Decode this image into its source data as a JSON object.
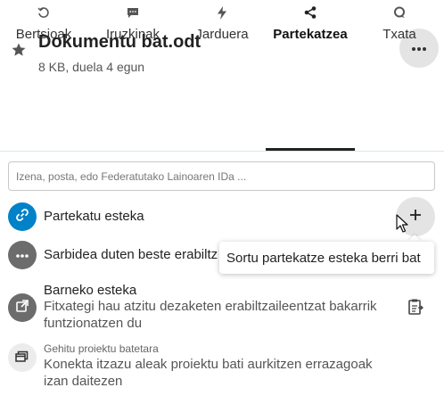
{
  "header": {
    "title": "Dokumentu bat.odt",
    "subtitle": "8 KB, duela 4 egun",
    "favorite_icon": "star-icon",
    "more_icon": "more-horizontal-icon"
  },
  "tabs": [
    {
      "label": "Bertsioak",
      "icon": "history-icon"
    },
    {
      "label": "Iruzkinak",
      "icon": "comment-icon"
    },
    {
      "label": "Jarduera",
      "icon": "activity-bolt-icon"
    },
    {
      "label": "Partekatzea",
      "icon": "share-icon",
      "active": true
    },
    {
      "label": "Txata",
      "icon": "talk-icon"
    }
  ],
  "search": {
    "placeholder": "Izena, posta, edo Federatutako Lainoaren IDa ..."
  },
  "share_link": {
    "label": "Partekatu esteka",
    "add_icon": "plus-icon"
  },
  "others_with_access": {
    "label": "Sarbidea duten beste erabiltz"
  },
  "tooltip": {
    "text": "Sortu partekatze esteka berri bat"
  },
  "internal_link": {
    "title": "Barneko esteka",
    "description": "Fitxategi hau atzitu dezaketen erabiltzaileentzat bakarrik funtzionatzen du"
  },
  "project": {
    "small_label": "Gehitu proiektu batetara",
    "description": "Konekta itzazu aleak proiektu bati aurkitzen errazagoak izan daitezen"
  },
  "colors": {
    "accent": "#0082c9",
    "grey_avatar": "#6c6c6c",
    "button_bg": "#e4e4e4"
  }
}
